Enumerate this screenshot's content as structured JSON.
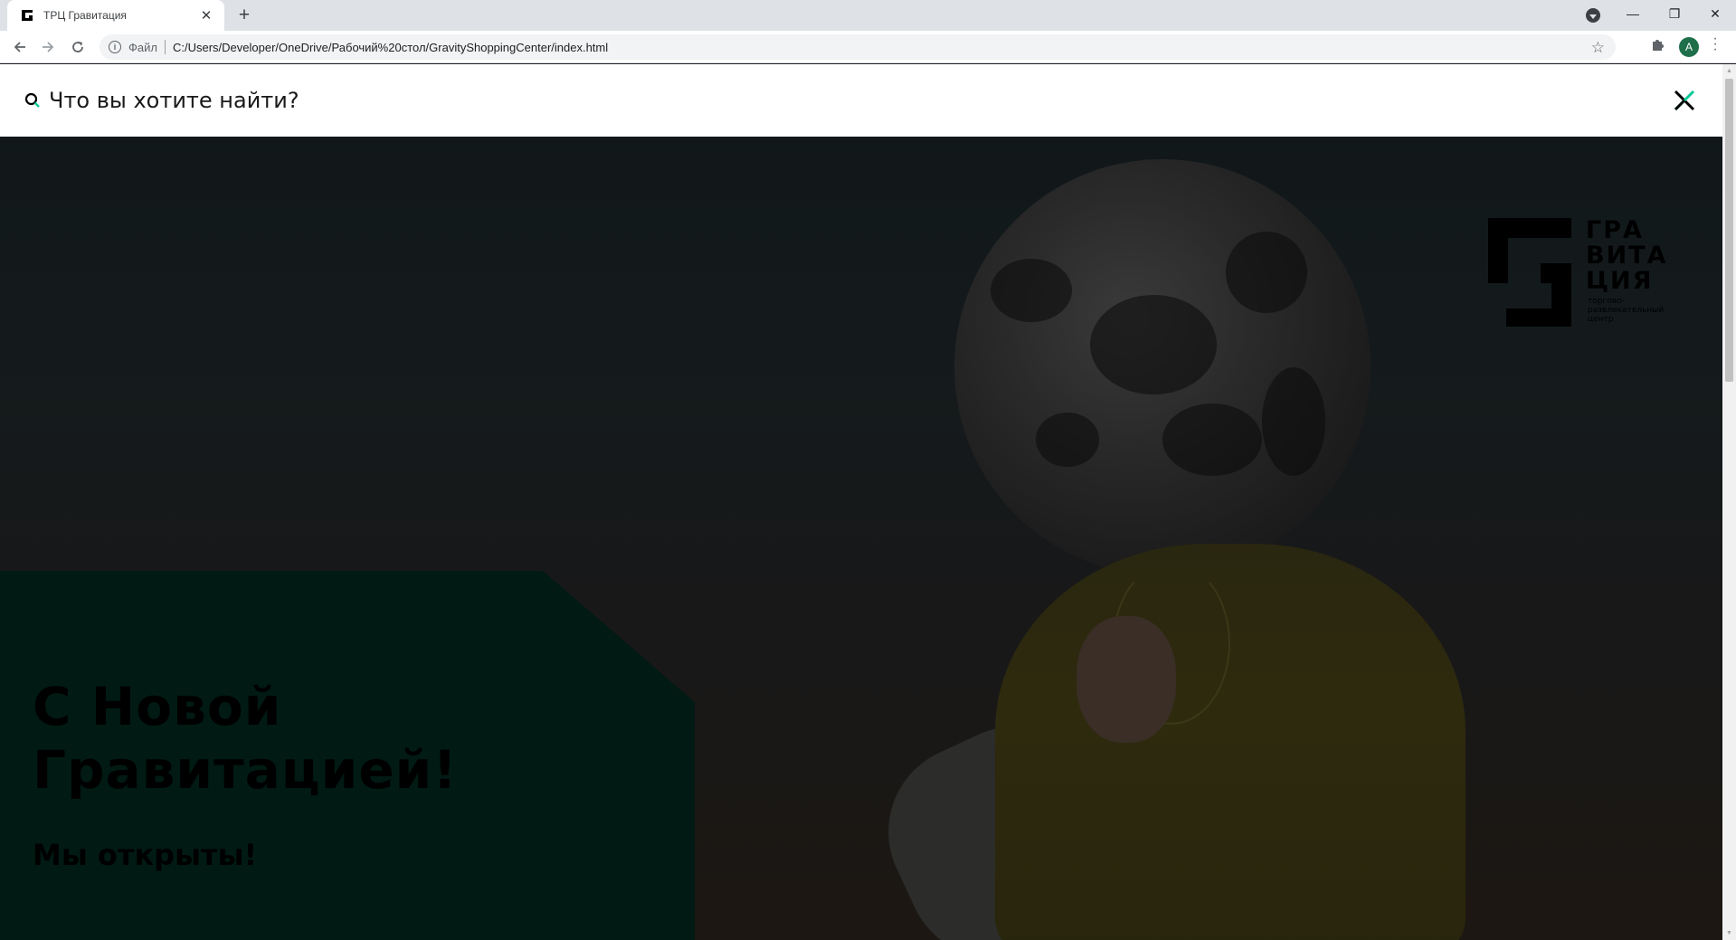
{
  "browser": {
    "tab_title": "ТРЦ Гравитация",
    "tab_close": "✕",
    "new_tab": "+",
    "scheme_label": "Файл",
    "url": "C:/Users/Developer/OneDrive/Рабочий%20стол/GravityShoppingCenter/index.html",
    "avatar_letter": "A",
    "window_controls": {
      "minimize": "—",
      "restore": "❐",
      "close": "✕"
    }
  },
  "search": {
    "placeholder": "Что вы хотите найти?",
    "accent_color": "#00c896"
  },
  "hero": {
    "title_line1": "С Новой",
    "title_line2": "Гравитацией!",
    "subtitle": "Мы открыты!",
    "panel_color": "#011a14"
  },
  "logo": {
    "line1": "ГРА",
    "line2": "ВИТА",
    "line3": "ЦИЯ",
    "tagline1": "торгово-",
    "tagline2": "развлекательный",
    "tagline3": "центр"
  }
}
